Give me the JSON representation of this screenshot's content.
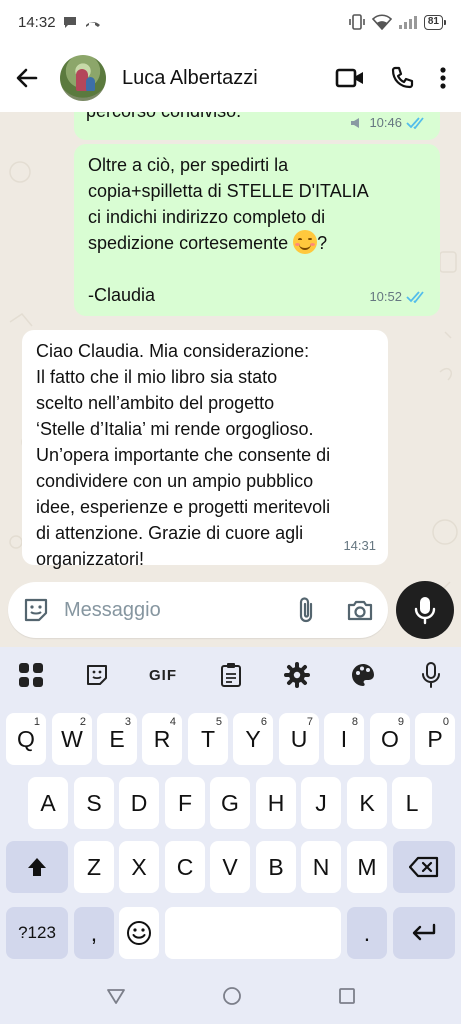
{
  "status_bar": {
    "time": "14:32",
    "battery": "81"
  },
  "header": {
    "contact_name": "Luca Albertazzi"
  },
  "messages": [
    {
      "direction": "out",
      "text": "percorso condiviso.",
      "time": "10:46"
    },
    {
      "direction": "out",
      "lines": [
        "Oltre a ciò, per spedirti la",
        "copia+spilletta di STELLE D'ITALIA",
        "ci indichi indirizzo completo di",
        "spedizione cortesemente",
        "?",
        "-Claudia"
      ],
      "time": "10:52"
    },
    {
      "direction": "in",
      "lines": [
        "Ciao Claudia. Mia considerazione:",
        "Il fatto che il mio libro sia stato",
        "scelto nell’ambito del progetto",
        "‘Stelle d’Italia’ mi rende orgoglioso.",
        "Un’opera importante che consente di",
        "condividere con un ampio pubblico",
        "idee, esperienze e progetti meritevoli",
        "di attenzione. Grazie di cuore agli",
        "organizzatori!"
      ],
      "time": "14:31"
    }
  ],
  "composer": {
    "placeholder": "Messaggio"
  },
  "keyboard": {
    "toolbar": {
      "gif": "GIF"
    },
    "row1": [
      "Q",
      "W",
      "E",
      "R",
      "T",
      "Y",
      "U",
      "I",
      "O",
      "P"
    ],
    "row1_hints": [
      "1",
      "2",
      "3",
      "4",
      "5",
      "6",
      "7",
      "8",
      "9",
      "0"
    ],
    "row2": [
      "A",
      "S",
      "D",
      "F",
      "G",
      "H",
      "J",
      "K",
      "L"
    ],
    "row3": [
      "Z",
      "X",
      "C",
      "V",
      "B",
      "N",
      "M"
    ],
    "symbols": "?123",
    "comma": ",",
    "period": "."
  },
  "colors": {
    "outgoing_bubble": "#d9fdd3",
    "incoming_bubble": "#ffffff",
    "chat_background": "#efeae2",
    "tick_blue": "#53bdeb",
    "keyboard_bg": "#e8ebf6"
  }
}
